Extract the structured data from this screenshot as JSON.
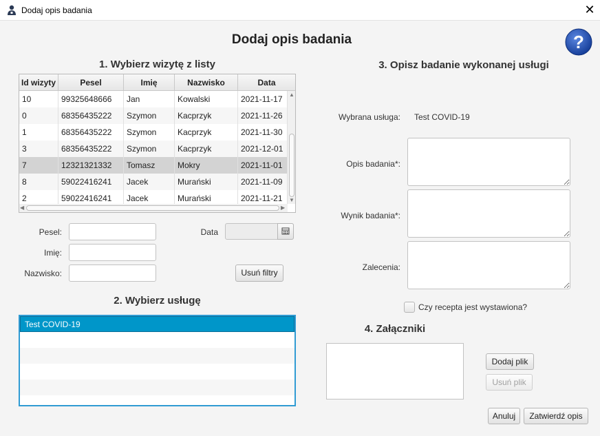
{
  "window": {
    "title": "Dodaj opis badania",
    "close_label": "✕"
  },
  "header": {
    "title": "Dodaj opis badania",
    "help_label": "?"
  },
  "section1": {
    "title": "1. Wybierz wizytę z listy",
    "columns": [
      "Id wizyty",
      "Pesel",
      "Imię",
      "Nazwisko",
      "Data"
    ],
    "rows": [
      [
        "10",
        "99325648666",
        "Jan",
        "Kowalski",
        "2021-11-17"
      ],
      [
        "0",
        "68356435222",
        "Szymon",
        "Kacprzyk",
        "2021-11-26"
      ],
      [
        "1",
        "68356435222",
        "Szymon",
        "Kacprzyk",
        "2021-11-30"
      ],
      [
        "3",
        "68356435222",
        "Szymon",
        "Kacprzyk",
        "2021-12-01"
      ],
      [
        "7",
        "12321321332",
        "Tomasz",
        "Mokry",
        "2021-11-01"
      ],
      [
        "8",
        "59022416241",
        "Jacek",
        "Murański",
        "2021-11-09"
      ],
      [
        "2",
        "59022416241",
        "Jacek",
        "Murański",
        "2021-11-21"
      ]
    ],
    "selected_row": 4,
    "filters": {
      "pesel_label": "Pesel:",
      "pesel_value": "",
      "imie_label": "Imię:",
      "imie_value": "",
      "nazwisko_label": "Nazwisko:",
      "nazwisko_value": "",
      "data_label": "Data",
      "data_value": "",
      "clear_button": "Usuń filtry"
    }
  },
  "section2": {
    "title": "2. Wybierz usługę",
    "items": [
      "Test COVID-19"
    ],
    "selected_index": 0
  },
  "section3": {
    "title": "3. Opisz badanie wykonanej usługi",
    "service_label": "Wybrana usługa:",
    "service_value": "Test COVID-19",
    "opis_label": "Opis badania*:",
    "opis_value": "",
    "wynik_label": "Wynik badania*:",
    "wynik_value": "",
    "zalecenia_label": "Zalecenia:",
    "zalecenia_value": "",
    "recepta_label": "Czy recepta jest wystawiona?",
    "recepta_checked": false
  },
  "section4": {
    "title": "4. Załączniki",
    "add_button": "Dodaj plik",
    "remove_button": "Usuń plik"
  },
  "footer": {
    "cancel_button": "Anuluj",
    "confirm_button": "Zatwierdź opis"
  },
  "colors": {
    "accent": "#0096c9",
    "focus_border": "#2f9bd3",
    "selected_row": "#d3d3d3",
    "help_icon": "#1f4fa8"
  }
}
